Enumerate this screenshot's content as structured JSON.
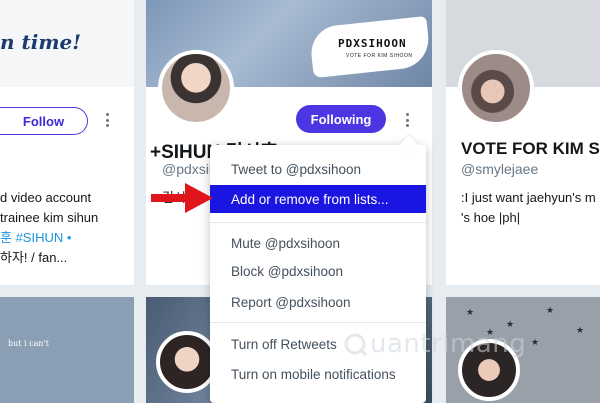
{
  "card1": {
    "banner_text": "n time!",
    "follow_label": "Follow",
    "bio_lines": [
      "d video account",
      "trainee kim sihun",
      "훈 #SIHUN •",
      "하자! / fan..."
    ]
  },
  "card2": {
    "banner_logo": "PDXSIHOON",
    "banner_sub": "VOTE FOR KIM SIHOON",
    "following_label": "Following",
    "name": "+SIHUN 김시훈",
    "handle": "@pdxsihoon",
    "bio_partial": "김시훈"
  },
  "card3": {
    "name": "VOTE FOR KIM S",
    "handle": "@smylejaee",
    "bio_lines": [
      ":I just want jaehyun's m",
      "'s hoe |ph|"
    ]
  },
  "card4": {
    "bubble_text": "but i can't"
  },
  "menu": {
    "items": [
      "Tweet to @pdxsihoon",
      "Add or remove from lists...",
      "Mute @pdxsihoon",
      "Block @pdxsihoon",
      "Report @pdxsihoon",
      "Turn off Retweets",
      "Turn on mobile notifications"
    ]
  },
  "watermark": "uantrimang",
  "colors": {
    "accent": "#4c36e4",
    "active_menu": "#1a15e0",
    "arrow": "#e0141b"
  },
  "icons": [
    "more-vertical-icon",
    "red-arrow-icon",
    "quantrimang-logo-icon"
  ]
}
